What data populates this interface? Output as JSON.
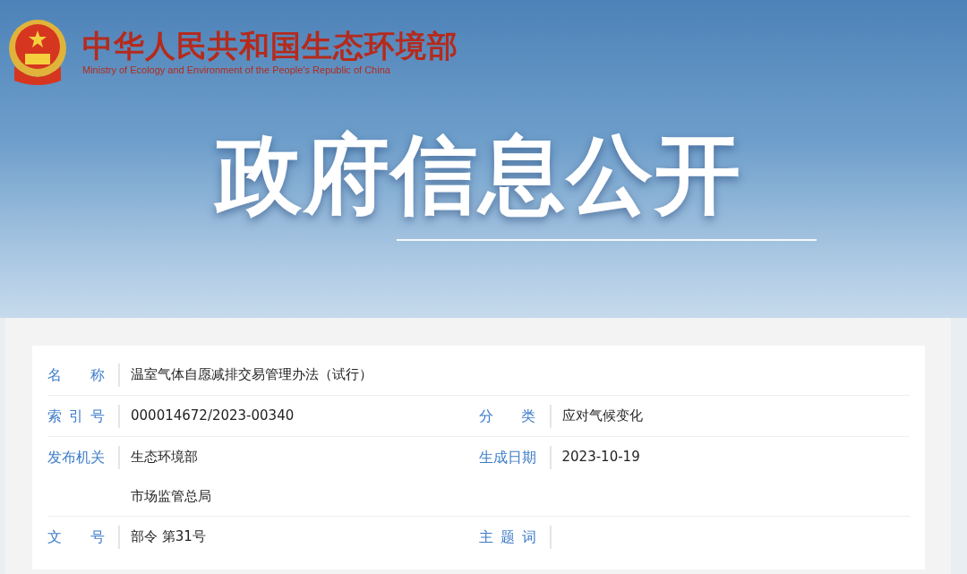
{
  "header": {
    "title": "中华人民共和国生态环境部",
    "subtitle": "Ministry of Ecology and Environment of the People's Republic of China"
  },
  "banner": {
    "title": "政府信息公开"
  },
  "info_rows": [
    {
      "cells": [
        {
          "label": "名 称",
          "values": [
            "温室气体自愿减排交易管理办法（试行）"
          ]
        }
      ]
    },
    {
      "cells": [
        {
          "label": "索 引 号",
          "values": [
            "000014672/2023-00340"
          ]
        },
        {
          "label": "分 类",
          "values": [
            "应对气候变化"
          ]
        }
      ]
    },
    {
      "cells": [
        {
          "label": "发布机关",
          "values": [
            "生态环境部",
            "市场监管总局"
          ]
        },
        {
          "label": "生成日期",
          "values": [
            "2023-10-19"
          ]
        }
      ]
    },
    {
      "cells": [
        {
          "label": "文 号",
          "values": [
            "部令 第31号"
          ]
        },
        {
          "label": "主 题 词"
        }
      ]
    }
  ]
}
